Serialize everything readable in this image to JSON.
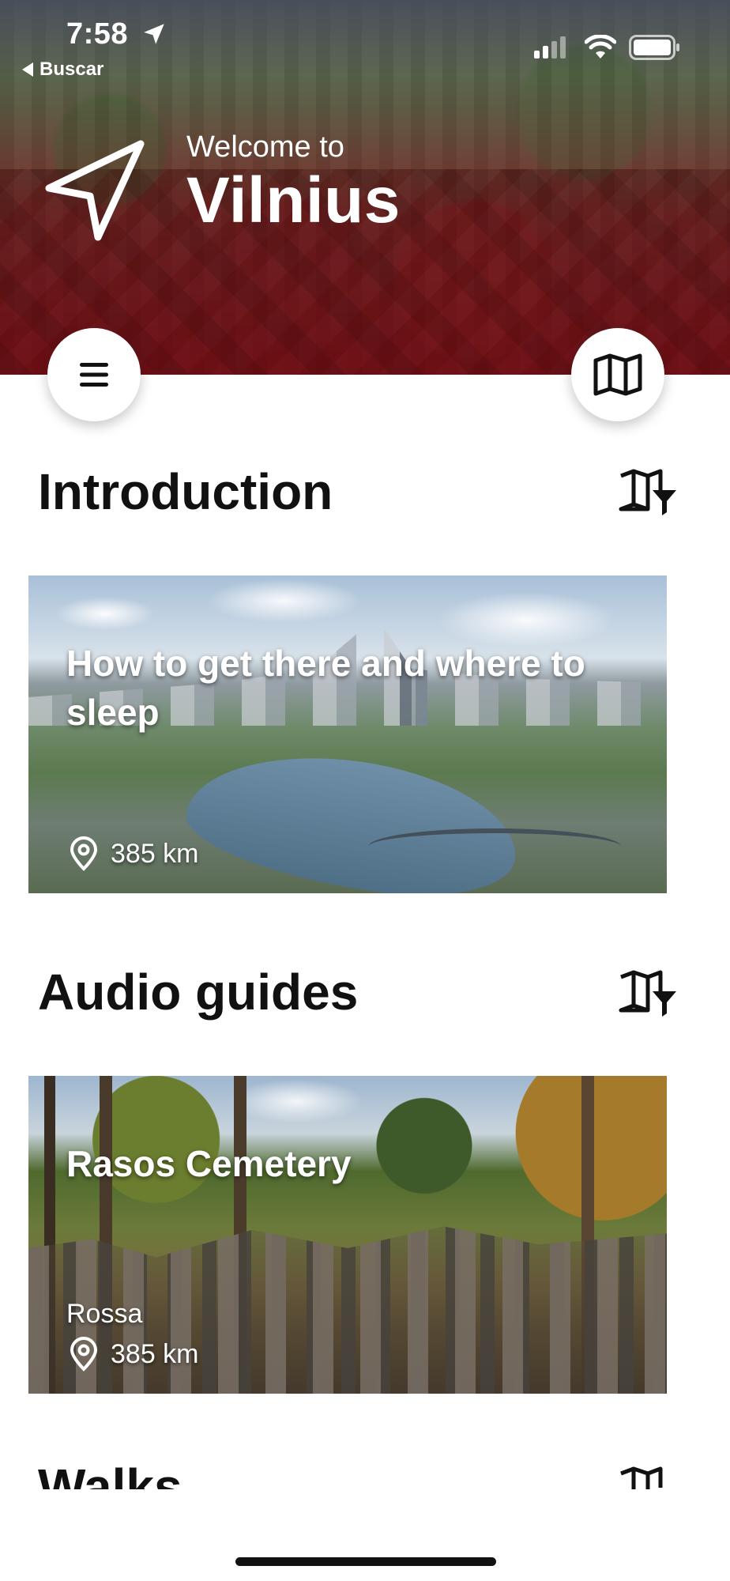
{
  "status_bar": {
    "time": "7:58",
    "back_label": "Buscar"
  },
  "header": {
    "welcome_small": "Welcome to",
    "city_name": "Vilnius"
  },
  "sections": [
    {
      "title": "Introduction",
      "cards": [
        {
          "title": "How to get there and where to sleep",
          "distance": "385 km"
        }
      ]
    },
    {
      "title": "Audio guides",
      "cards": [
        {
          "title": "Rasos Cemetery",
          "subtitle": "Rossa",
          "distance": "385 km"
        }
      ]
    },
    {
      "title": "Walks",
      "cards": []
    }
  ],
  "icons": {
    "navigation": "navigation-arrow-icon",
    "menu": "hamburger-menu-icon",
    "map": "folded-map-icon",
    "filter": "map-filter-icon",
    "pin": "location-pin-icon"
  },
  "colors": {
    "header_overlay": "#871218",
    "accent_text": "#111111",
    "card_text": "#ffffff"
  }
}
